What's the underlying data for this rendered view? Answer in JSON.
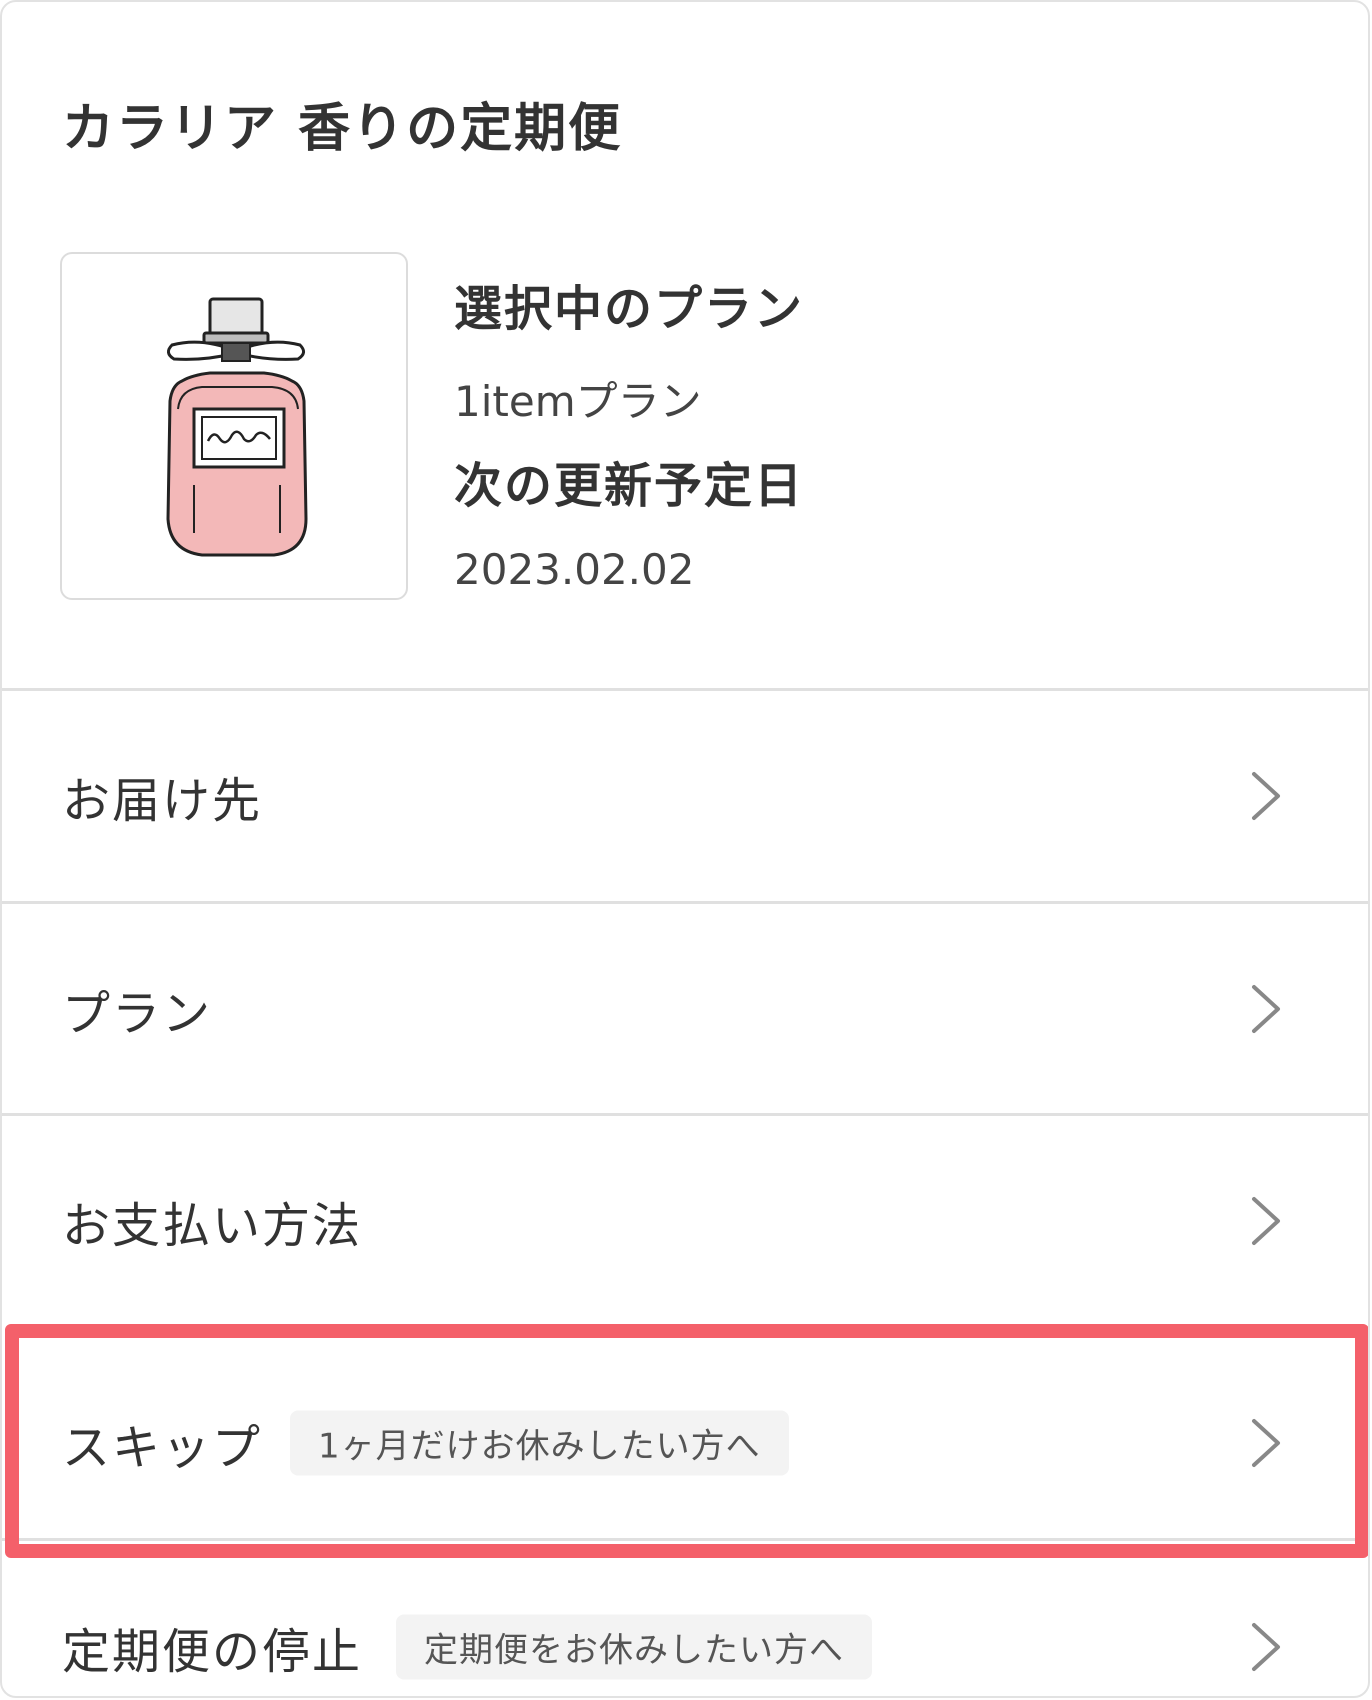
{
  "header": {
    "title": "カラリア 香りの定期便"
  },
  "subscription": {
    "plan_label": "選択中のプラン",
    "plan_value": "1itemプラン",
    "next_date_label": "次の更新予定日",
    "next_date_value": "2023.02.02",
    "product_image_icon": "perfume-bottle-icon"
  },
  "menu": {
    "items": [
      {
        "label": "お届け先",
        "note": ""
      },
      {
        "label": "プラン",
        "note": ""
      },
      {
        "label": "お支払い方法",
        "note": ""
      },
      {
        "label": "スキップ",
        "note": "1ヶ月だけお休みしたい方へ"
      },
      {
        "label": "定期便の停止",
        "note": "定期便をお休みしたい方へ"
      }
    ],
    "chevron_icon": "chevron-right-icon"
  },
  "colors": {
    "highlight": "#f4606a",
    "bottle_fill": "#f3b8b8",
    "note_bg": "#f3f3f3",
    "divider": "#e0e0e0"
  }
}
